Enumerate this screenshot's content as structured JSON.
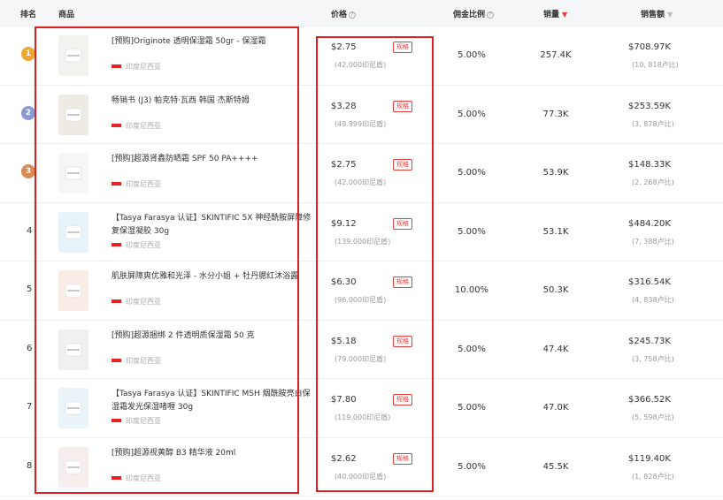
{
  "headers": {
    "rank": "排名",
    "product": "商品",
    "price": "价格",
    "commission": "佣金比例",
    "sales": "销量",
    "revenue": "销售额"
  },
  "colors": {
    "accent": "#e63c3c",
    "highlight_box": "#e02020",
    "gold": "#f0a52c",
    "silver": "#8a9bd0",
    "bronze": "#d88a52"
  },
  "tag_label": "规格",
  "rows": [
    {
      "rank": "1",
      "title": "[预购]Originote 透明保湿霜 50gr - 保湿霜",
      "region": "印度尼西亚",
      "price": "$2.75",
      "price_local": "(42.000印尼盾)",
      "commission": "5.00%",
      "sales": "257.4K",
      "revenue": "$708.97K",
      "revenue_ratio": "(10, 818卢比)"
    },
    {
      "rank": "2",
      "title": "畅销书 (J3) 帕克特·瓦西 韩国 杰斯特姆",
      "region": "印度尼西亚",
      "price": "$3.28",
      "price_local": "(49.999印尼盾)",
      "commission": "5.00%",
      "sales": "77.3K",
      "revenue": "$253.59K",
      "revenue_ratio": "(3, 878卢比)"
    },
    {
      "rank": "3",
      "title": "[预购]超源肾鑫防晒霜 SPF 50 PA++++",
      "region": "印度尼西亚",
      "price": "$2.75",
      "price_local": "(42.000印尼盾)",
      "commission": "5.00%",
      "sales": "53.9K",
      "revenue": "$148.33K",
      "revenue_ratio": "(2, 268卢比)"
    },
    {
      "rank": "4",
      "title": "【Tasya Farasya 认证】SKINTIFIC 5X 神经酰胺屏障修复保湿凝胶 30g",
      "region": "印度尼西亚",
      "price": "$9.12",
      "price_local": "(139.000印尼盾)",
      "commission": "5.00%",
      "sales": "53.1K",
      "revenue": "$484.20K",
      "revenue_ratio": "(7, 388卢比)"
    },
    {
      "rank": "5",
      "title": "肌肤屏障爽优雅和光泽 - 水分小姐 + 牡丹腮红沐浴露",
      "region": "印度尼西亚",
      "price": "$6.30",
      "price_local": "(96.000印尼盾)",
      "commission": "10.00%",
      "sales": "50.3K",
      "revenue": "$316.54K",
      "revenue_ratio": "(4, 838卢比)"
    },
    {
      "rank": "6",
      "title": "[预购]超源捆绑 2 件透明质保湿霜 50 克",
      "region": "印度尼西亚",
      "price": "$5.18",
      "price_local": "(79.000印尼盾)",
      "commission": "5.00%",
      "sales": "47.4K",
      "revenue": "$245.73K",
      "revenue_ratio": "(3, 758卢比)"
    },
    {
      "rank": "7",
      "title": "【Tasya Farasya 认证】SKINTIFIC MSH 烟酰胺亮白保湿霜发光保湿啫喱 30g",
      "region": "印度尼西亚",
      "price": "$7.80",
      "price_local": "(119.000印尼盾)",
      "commission": "5.00%",
      "sales": "47.0K",
      "revenue": "$366.52K",
      "revenue_ratio": "(5, 598卢比)"
    },
    {
      "rank": "8",
      "title": "[预购]超源视黄醇 B3 精华液 20ml",
      "region": "印度尼西亚",
      "price": "$2.62",
      "price_local": "(40.000印尼盾)",
      "commission": "5.00%",
      "sales": "45.5K",
      "revenue": "$119.40K",
      "revenue_ratio": "(1, 828卢比)"
    }
  ]
}
